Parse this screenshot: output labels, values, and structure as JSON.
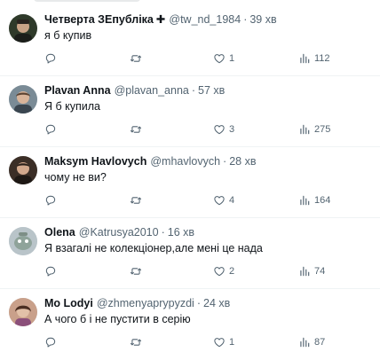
{
  "tweets": [
    {
      "name": "Четверта ЗЕпубліка",
      "badge": "✚",
      "handle": "@tw_nd_1984",
      "time": "39 хв",
      "text": "я б купив",
      "replies": "",
      "retweets": "",
      "likes": "1",
      "views": "112",
      "avatar_color": "#2f3a2a"
    },
    {
      "name": "Plavan Anna",
      "badge": "",
      "handle": "@plavan_anna",
      "time": "57 хв",
      "text": "Я б купила",
      "replies": "",
      "retweets": "",
      "likes": "3",
      "views": "275",
      "avatar_color": "#7a8b96"
    },
    {
      "name": "Maksym Havlovych",
      "badge": "",
      "handle": "@mhavlovych",
      "time": "28 хв",
      "text": "чому не ви?",
      "replies": "",
      "retweets": "",
      "likes": "4",
      "views": "164",
      "avatar_color": "#3b2e26"
    },
    {
      "name": "Olena",
      "badge": "",
      "handle": "@Katrusya2010",
      "time": "16 хв",
      "text": "Я взагалі не колекціонер,але мені це нада",
      "replies": "",
      "retweets": "",
      "likes": "2",
      "views": "74",
      "avatar_color": "#b9c4c9"
    },
    {
      "name": "Mo Lodyi",
      "badge": "",
      "handle": "@zhmenyaprypyzdi",
      "time": "24 хв",
      "text": "А чого б і не пустити в серію",
      "replies": "",
      "retweets": "",
      "likes": "1",
      "views": "87",
      "avatar_color": "#c9a08a"
    }
  ],
  "separator": "·",
  "icons": {
    "reply": "reply-icon",
    "retweet": "retweet-icon",
    "like": "heart-icon",
    "views": "views-icon"
  }
}
